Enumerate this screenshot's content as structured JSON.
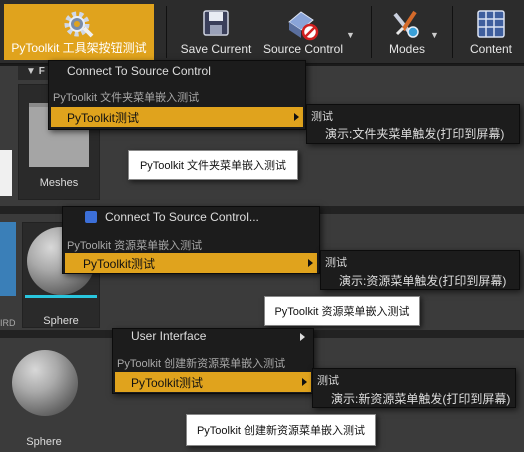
{
  "toolbar": {
    "buttons": [
      {
        "label": "PyToolkit 工具架按钮测试",
        "icon": "gear-icon",
        "active": true
      },
      {
        "label": "Save Current",
        "icon": "floppy-icon"
      },
      {
        "label": "Source Control",
        "icon": "source-control-icon"
      },
      {
        "label": "Modes",
        "icon": "modes-icon"
      },
      {
        "label": "Content",
        "icon": "content-grid-icon"
      }
    ]
  },
  "folder_section": {
    "filter_label": "F",
    "folder_name": "Meshes",
    "menu": {
      "top_item": "Connect To Source Control",
      "section_header": "PyToolkit 文件夹菜单嵌入测试",
      "highlight_item": "PyToolkit测试",
      "submenu": {
        "header": "测试",
        "item": "演示:文件夹菜单触发(打印到屏幕)"
      }
    },
    "tooltip": "PyToolkit 文件夹菜单嵌入测试"
  },
  "asset_section": {
    "asset_name": "Sphere",
    "side_text": "IRD",
    "menu": {
      "top_item": "Connect To Source Control...",
      "section_header": "PyToolkit 资源菜单嵌入测试",
      "highlight_item": "PyToolkit测试",
      "submenu": {
        "header": "测试",
        "item": "演示:资源菜单触发(打印到屏幕)"
      }
    },
    "tooltip": "PyToolkit 资源菜单嵌入测试"
  },
  "new_asset_section": {
    "asset_name": "Sphere",
    "menu": {
      "top_item": "User Interface",
      "section_header": "PyToolkit 创建新资源菜单嵌入测试",
      "highlight_item": "PyToolkit测试",
      "submenu": {
        "header": "测试",
        "item": "演示:新资源菜单触发(打印到屏幕)"
      }
    },
    "tooltip": "PyToolkit 创建新资源菜单嵌入测试"
  },
  "colors": {
    "accent": "#e0a31d",
    "menu_bg": "#1c1c1c",
    "panel_bg": "#3b3b3b",
    "asset_underline": "#29c6de"
  }
}
